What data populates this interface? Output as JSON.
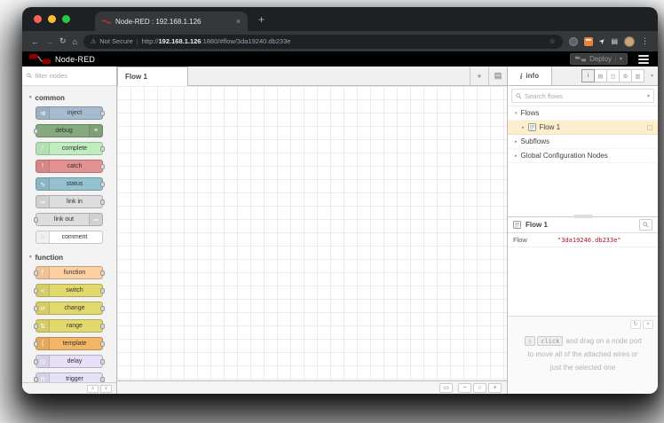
{
  "browser": {
    "tab_title": "Node-RED : 192.168.1.126",
    "not_secure": "Not Secure",
    "url_scheme": "http://",
    "url_host": "192.168.1.126",
    "url_rest": ":1880/#flow/3da19240.db233e"
  },
  "header": {
    "app_title": "Node-RED",
    "deploy_label": "Deploy"
  },
  "workspace": {
    "tab_label": "Flow 1"
  },
  "palette": {
    "filter_placeholder": "filter nodes",
    "sections": [
      {
        "label": "common",
        "nodes": [
          {
            "label": "inject",
            "color": "#a6bbcf",
            "glyph": "⇉",
            "icon_name": "inject-icon",
            "icon_side": "left",
            "ports": "right"
          },
          {
            "label": "debug",
            "color": "#87a980",
            "glyph": "≡",
            "icon_name": "debug-icon",
            "icon_side": "right",
            "ports": "left"
          },
          {
            "label": "complete",
            "color": "#c0edc0",
            "glyph": "!",
            "icon_name": "complete-icon",
            "icon_side": "left",
            "ports": "right"
          },
          {
            "label": "catch",
            "color": "#e49191",
            "glyph": "!",
            "icon_name": "catch-icon",
            "icon_side": "left",
            "ports": "right"
          },
          {
            "label": "status",
            "color": "#94c1d0",
            "glyph": "∿",
            "icon_name": "status-icon",
            "icon_side": "left",
            "ports": "right"
          },
          {
            "label": "link in",
            "color": "#dddddd",
            "glyph": "⇒",
            "icon_name": "link-in-icon",
            "icon_side": "left",
            "ports": "right"
          },
          {
            "label": "link out",
            "color": "#dddddd",
            "glyph": "⇒",
            "icon_name": "link-out-icon",
            "icon_side": "right",
            "ports": "left"
          },
          {
            "label": "comment",
            "color": "#ffffff",
            "glyph": "○",
            "glyph_color": "#aaaaaa",
            "icon_name": "comment-icon",
            "icon_side": "left",
            "ports": "none"
          }
        ]
      },
      {
        "label": "function",
        "nodes": [
          {
            "label": "function",
            "color": "#fdd0a2",
            "glyph": "ƒ",
            "icon_name": "function-icon",
            "icon_side": "left",
            "ports": "both"
          },
          {
            "label": "switch",
            "color": "#e2d96e",
            "glyph": "≺",
            "icon_name": "switch-icon",
            "icon_side": "left",
            "ports": "both"
          },
          {
            "label": "change",
            "color": "#e2d96e",
            "glyph": "⇄",
            "icon_name": "change-icon",
            "icon_side": "left",
            "ports": "both"
          },
          {
            "label": "range",
            "color": "#e2d96e",
            "glyph": "⇅",
            "icon_name": "range-icon",
            "icon_side": "left",
            "ports": "both"
          },
          {
            "label": "template",
            "color": "#f3b567",
            "glyph": "{",
            "icon_name": "template-icon",
            "icon_side": "left",
            "ports": "both"
          },
          {
            "label": "delay",
            "color": "#e6e0f8",
            "glyph": "◷",
            "icon_name": "delay-icon",
            "icon_side": "left",
            "ports": "both"
          },
          {
            "label": "trigger",
            "color": "#e6e0f8",
            "glyph": "⊓",
            "icon_name": "trigger-icon",
            "icon_side": "left",
            "ports": "both"
          }
        ]
      }
    ]
  },
  "sidebar": {
    "info_label": "info",
    "search_placeholder": "Search flows",
    "toolbar": [
      {
        "name": "info-tab-button",
        "glyph": "i",
        "active": true
      },
      {
        "name": "help-tab-button",
        "glyph": "▤"
      },
      {
        "name": "debug-tab-button",
        "glyph": "◫"
      },
      {
        "name": "config-tab-button",
        "glyph": "⚙"
      },
      {
        "name": "context-tab-button",
        "glyph": "▥"
      }
    ],
    "tree": {
      "flows": "Flows",
      "flow1": "Flow 1",
      "subflows": "Subflows",
      "global_config": "Global Configuration Nodes"
    },
    "detail": {
      "title": "Flow 1",
      "prop_label": "Flow",
      "prop_value": "\"3da19240.db233e\""
    },
    "tips": {
      "kbd_shift": "⇧",
      "kbd_click": "click",
      "line1": " and drag on a node port",
      "line2": "to move all of the attached wires or",
      "line3": "just the selected one"
    }
  },
  "glyphs": {
    "back": "←",
    "forward": "→",
    "reload": "↻",
    "home": "⌂",
    "warn": "⚠",
    "star": "☆",
    "pin": "➤",
    "list": "▤",
    "menu_dots": "⋮",
    "tab_close": "×",
    "new_tab": "+",
    "caret_down": "▾",
    "chev_down": "▾",
    "chev_right": "▸",
    "plus": "+",
    "list_tabs": "▤",
    "map": "▭",
    "minus": "−",
    "zoom_reset": "○",
    "zoom_in": "+",
    "up": "∧",
    "down": "∨",
    "tip_refresh": "↻",
    "tip_close": "×",
    "info_i": "i",
    "url_sep": "|"
  },
  "colors": {
    "traffic_red": "#ff5f57",
    "traffic_yellow": "#febc2e",
    "traffic_green": "#28c840",
    "nodered_red": "#8f0000",
    "selected_row": "#fdeecd",
    "string_value_red": "#ad1625",
    "extension_orange": "#e8833a"
  }
}
